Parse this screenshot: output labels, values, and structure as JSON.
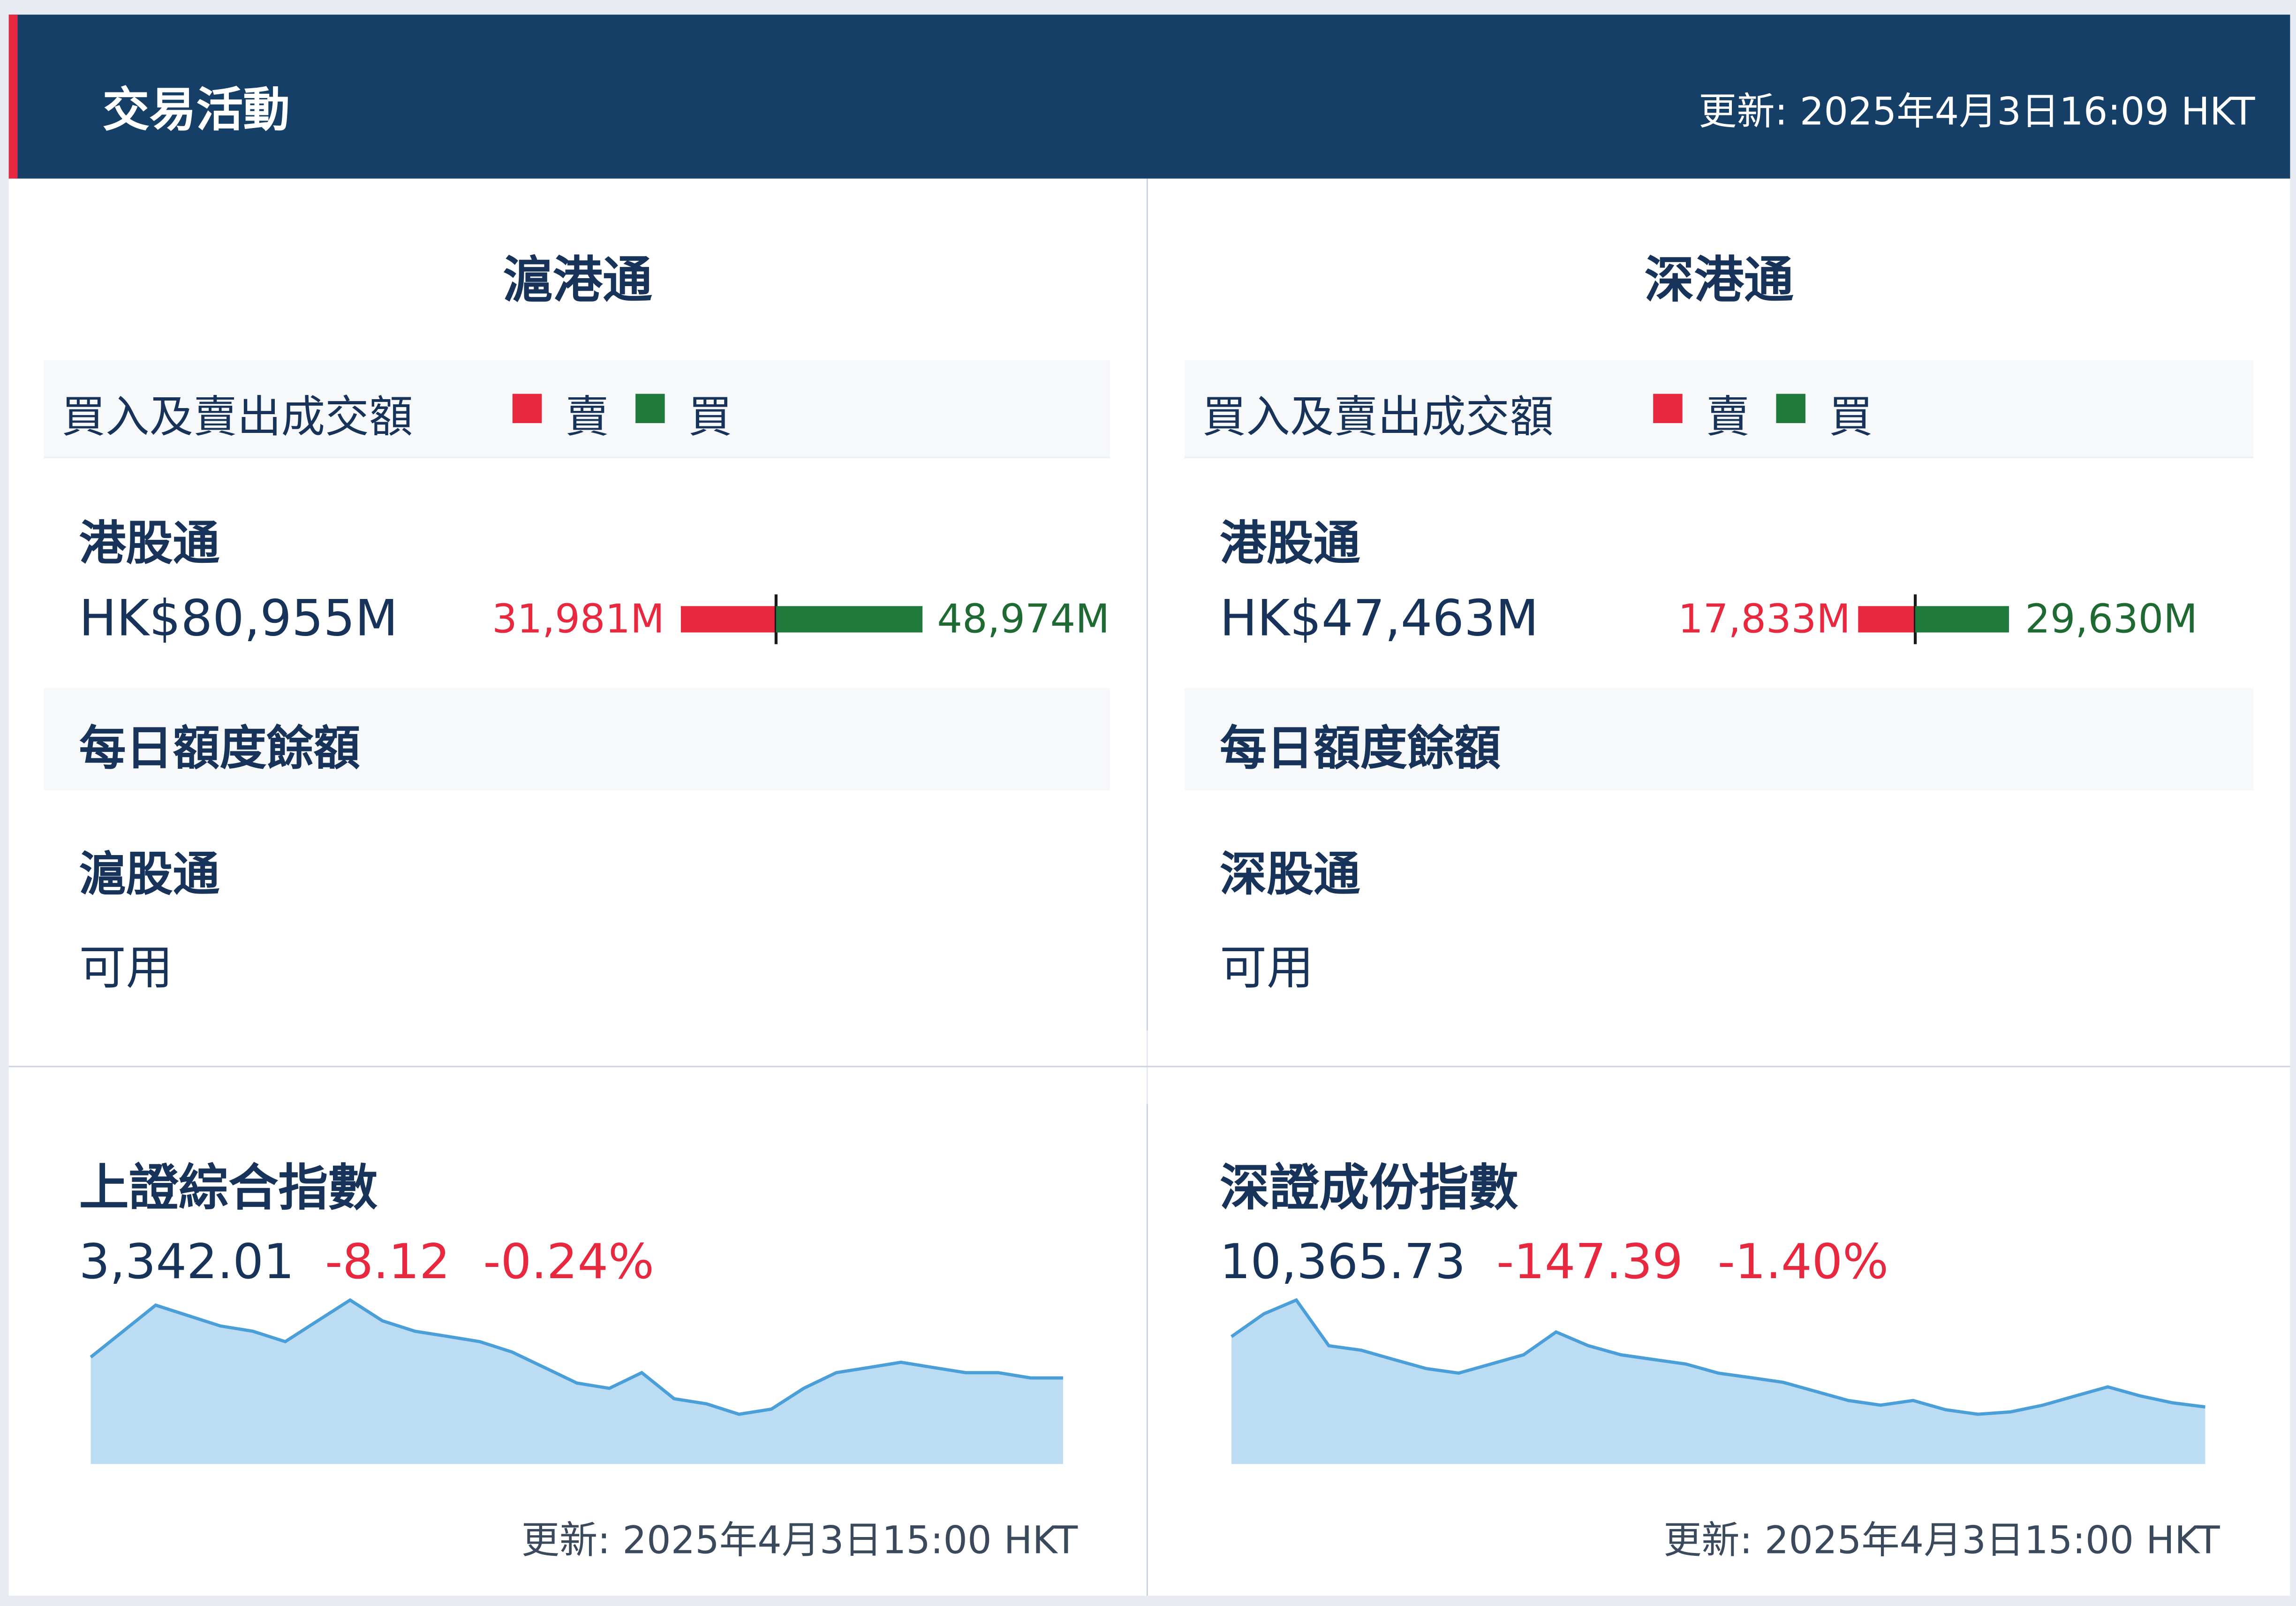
{
  "header": {
    "title": "交易活動",
    "updated": "更新: 2025年4月3日16:09 HKT"
  },
  "connect": [
    {
      "title": "滬港通",
      "turnover_label": "買入及賣出成交額",
      "legend_sell": "賣",
      "legend_buy": "買",
      "southbound_label": "港股通",
      "total": "HK$80,955M",
      "sell": "31,981M",
      "buy": "48,974M",
      "sell_amount": 31981,
      "buy_amount": 48974,
      "quota_label": "每日額度餘額",
      "northbound_label": "滬股通",
      "northbound_status": "可用"
    },
    {
      "title": "深港通",
      "turnover_label": "買入及賣出成交額",
      "legend_sell": "賣",
      "legend_buy": "買",
      "southbound_label": "港股通",
      "total": "HK$47,463M",
      "sell": "17,833M",
      "buy": "29,630M",
      "sell_amount": 17833,
      "buy_amount": 29630,
      "quota_label": "每日額度餘額",
      "northbound_label": "深股通",
      "northbound_status": "可用"
    }
  ],
  "indices": [
    {
      "name": "上證綜合指數",
      "value": "3,342.01",
      "change": "-8.12",
      "change_pct": "-0.24%",
      "updated": "更新: 2025年4月3日15:00 HKT"
    },
    {
      "name": "深證成份指數",
      "value": "10,365.73",
      "change": "-147.39",
      "change_pct": "-1.40%",
      "updated": "更新: 2025年4月3日15:00 HKT"
    }
  ],
  "colors": {
    "header_bg": "#163f68",
    "accent_red": "#e8283f",
    "buy_green": "#1f7a3c",
    "chart_line": "#4a9fd8",
    "chart_fill": "#bcdcf3"
  },
  "chart_data": [
    {
      "type": "area",
      "series": [
        {
          "values": [
            3352,
            3357,
            3362,
            3360,
            3358,
            3357,
            3355,
            3359,
            3363,
            3359,
            3357,
            3356,
            3355,
            3353,
            3350,
            3347,
            3346,
            3349,
            3344,
            3343,
            3341,
            3342,
            3346,
            3349,
            3350,
            3351,
            3350,
            3349,
            3349,
            3348,
            3348
          ]
        }
      ]
    },
    {
      "type": "area",
      "series": [
        {
          "values": [
            10520,
            10570,
            10600,
            10500,
            10490,
            10470,
            10450,
            10440,
            10460,
            10480,
            10530,
            10500,
            10480,
            10470,
            10460,
            10440,
            10430,
            10420,
            10400,
            10380,
            10370,
            10380,
            10360,
            10350,
            10355,
            10370,
            10390,
            10410,
            10390,
            10375,
            10366
          ]
        }
      ]
    }
  ]
}
